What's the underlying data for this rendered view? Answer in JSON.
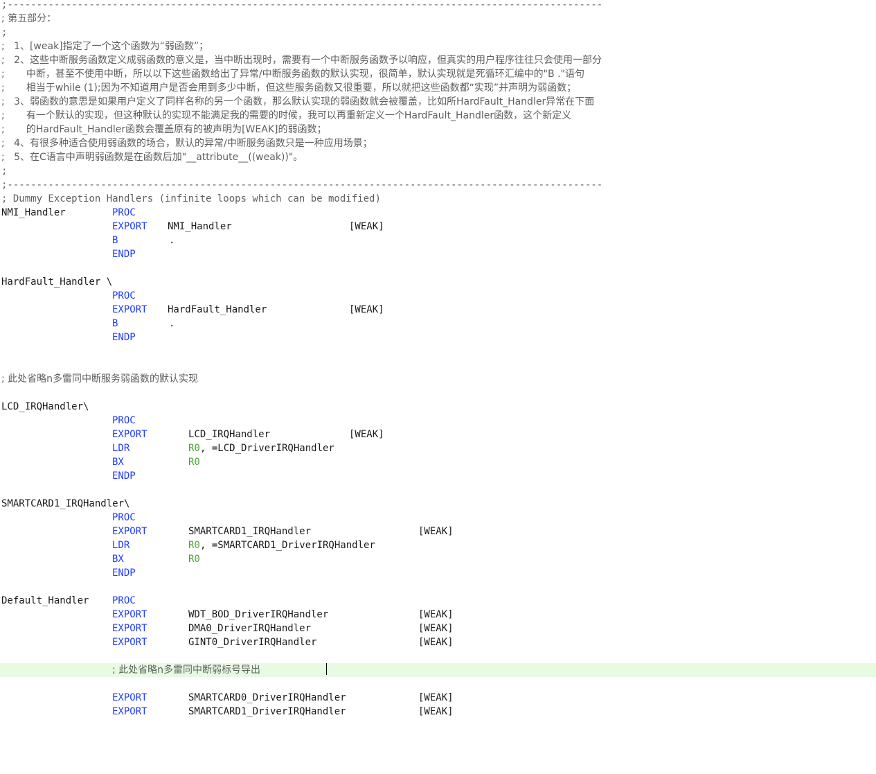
{
  "editor": {
    "colors": {
      "comment": "#5f5f5f",
      "keyword": "#1f3cff",
      "register": "#4ba32f",
      "text": "#1a1a1a",
      "current_line": "#e7fbe3"
    },
    "header": {
      "rule_top": ";------------------------------------------------------------------------------------------------------",
      "section_title": "; 第五部分：",
      "blank1": ";",
      "item1": ";   1、[weak]指定了一个这个函数为“弱函数”；",
      "item2a": ";   2、这些中断服务函数定义成弱函数的意义是，当中断出现时，需要有一个中断服务函数予以响应，但真实的用户程序往往只会使用一部分",
      "item2b": ";       中断，甚至不使用中断，所以以下这些函数给出了异常/中断服务函数的默认实现，很简单，默认实现就是死循环汇编中的\"B .\"语句",
      "item2c": ";       相当于while (1);因为不知道用户是否会用到多少中断，但这些服务函数又很重要，所以就把这些函数都“实现”并声明为弱函数；",
      "item3a": ";   3、弱函数的意思是如果用户定义了同样名称的另一个函数，那么默认实现的弱函数就会被覆盖，比如所HardFault_Handler异常在下面",
      "item3b": ";       有一个默认的实现，但这种默认的实现不能满足我的需要的时候，我可以再重新定义一个HardFault_Handler函数，这个新定义",
      "item3c": ";       的HardFault_Handler函数会覆盖原有的被声明为[WEAK]的弱函数；",
      "item4": ";   4、有很多种适合使用弱函数的场合，默认的异常/中断服务函数只是一种应用场景；",
      "item5": ";   5、在C语言中声明弱函数是在函数后加\"__attribute__((weak))\"。",
      "blank2": ";",
      "rule_bottom": ";------------------------------------------------------------------------------------------------------",
      "dummy_title": "; Dummy Exception Handlers (infinite loops which can be modified)"
    },
    "nmi": {
      "label": "NMI_Handler",
      "proc": "PROC",
      "export": "EXPORT",
      "name": "NMI_Handler",
      "weak": "[WEAK]",
      "b": "B",
      "dot": ".",
      "endp": "ENDP"
    },
    "hardfault": {
      "label": "HardFault_Handler \\",
      "proc": "PROC",
      "export": "EXPORT",
      "name": "HardFault_Handler",
      "weak": "[WEAK]",
      "b": "B",
      "dot": ".",
      "endp": "ENDP"
    },
    "omit_comment1": "; 此处省略n多雷同中断服务弱函数的默认实现",
    "lcd": {
      "label": "LCD_IRQHandler\\",
      "proc": "PROC",
      "export": "EXPORT",
      "name": "LCD_IRQHandler",
      "weak": "[WEAK]",
      "ldr": "LDR",
      "r0a": "R0",
      "ldr_arg": ", =LCD_DriverIRQHandler",
      "bx": "BX",
      "r0b": "R0",
      "endp": "ENDP"
    },
    "smartcard1": {
      "label": "SMARTCARD1_IRQHandler\\",
      "proc": "PROC",
      "export": "EXPORT",
      "name": "SMARTCARD1_IRQHandler",
      "weak": "[WEAK]",
      "ldr": "LDR",
      "r0a": "R0",
      "ldr_arg": ", =SMARTCARD1_DriverIRQHandler",
      "bx": "BX",
      "r0b": "R0",
      "endp": "ENDP"
    },
    "default": {
      "label": "Default_Handler",
      "proc": "PROC",
      "exports": [
        {
          "kw": "EXPORT",
          "name": "WDT_BOD_DriverIRQHandler",
          "weak": "[WEAK]"
        },
        {
          "kw": "EXPORT",
          "name": "DMA0_DriverIRQHandler",
          "weak": "[WEAK]"
        },
        {
          "kw": "EXPORT",
          "name": "GINT0_DriverIRQHandler",
          "weak": "[WEAK]"
        }
      ],
      "omit_comment2": "; 此处省略n多雷同中断弱标号导出",
      "exports2": [
        {
          "kw": "EXPORT",
          "name": "SMARTCARD0_DriverIRQHandler",
          "weak": "[WEAK]"
        },
        {
          "kw": "EXPORT",
          "name": "SMARTCARD1_DriverIRQHandler",
          "weak": "[WEAK]"
        }
      ]
    }
  }
}
